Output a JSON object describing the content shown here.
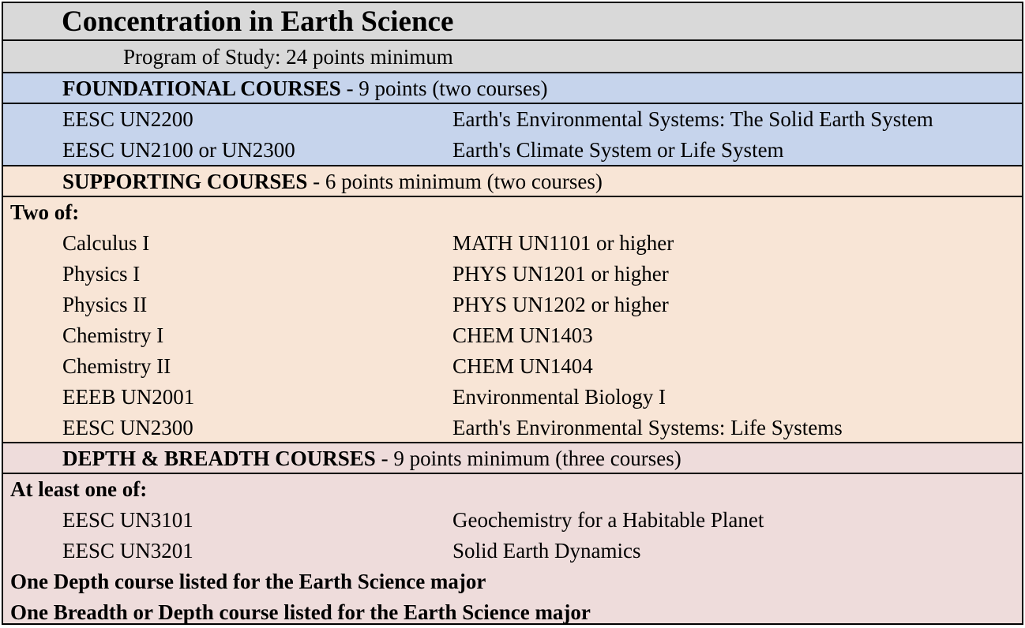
{
  "title": "Concentration in Earth Science",
  "program": "Program of Study: 24 points minimum",
  "foundational": {
    "heading": "FOUNDATIONAL COURSES",
    "detail": " -  9 points  (two courses)",
    "courses": [
      {
        "code": "EESC UN2200",
        "name": "Earth's Environmental Systems: The Solid Earth System"
      },
      {
        "code": "EESC UN2100 or UN2300",
        "name": "Earth's Climate System or Life System"
      }
    ]
  },
  "supporting": {
    "heading": "SUPPORTING COURSES",
    "detail": " - 6 points minimum (two courses)",
    "group_label": "Two of:",
    "courses": [
      {
        "code": "Calculus I",
        "name": "MATH UN1101 or higher"
      },
      {
        "code": "Physics I",
        "name": "PHYS UN1201 or higher"
      },
      {
        "code": "Physics II",
        "name": "PHYS UN1202 or higher"
      },
      {
        "code": "Chemistry I",
        "name": "CHEM UN1403"
      },
      {
        "code": "Chemistry II",
        "name": "CHEM UN1404"
      },
      {
        "code": "EEEB UN2001",
        "name": "Environmental Biology I"
      },
      {
        "code": "EESC UN2300",
        "name": "Earth's Environmental Systems: Life Systems"
      }
    ]
  },
  "depth": {
    "heading": "DEPTH & BREADTH COURSES",
    "detail": " -  9 points minimum (three courses)",
    "group_label": "At least one of:",
    "courses": [
      {
        "code": "EESC UN3101",
        "name": "Geochemistry for a Habitable Planet"
      },
      {
        "code": "EESC UN3201",
        "name": "Solid Earth Dynamics"
      }
    ],
    "notes": [
      "One Depth course listed  for the Earth Science major",
      "One Breadth or Depth course listed for the Earth Science major"
    ]
  },
  "colors": {
    "header_gray": "#d9d9d9",
    "foundational_blue": "#c6d4ec",
    "supporting_peach": "#f8e5d6",
    "depth_rose": "#eedcdb"
  }
}
